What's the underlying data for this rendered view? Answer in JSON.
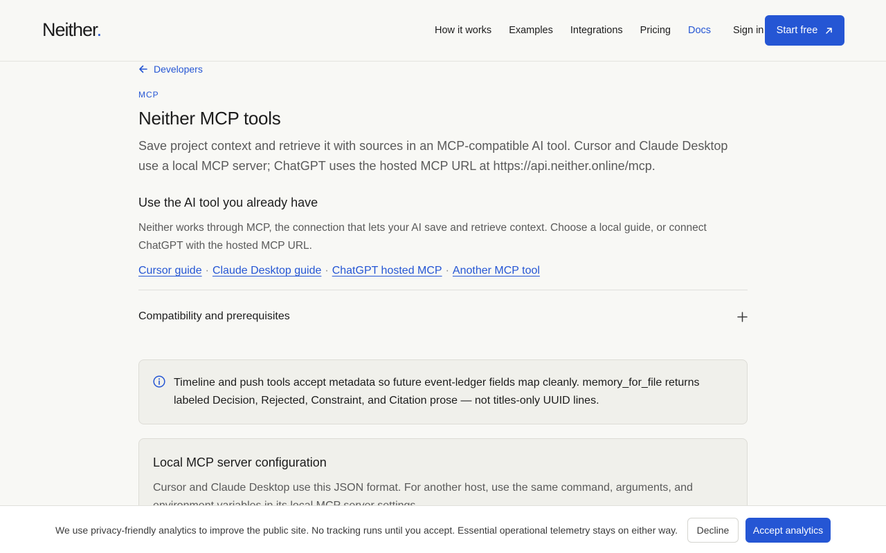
{
  "header": {
    "logo_text": "Neither",
    "logo_dot": ".",
    "nav": [
      {
        "label": "How it works"
      },
      {
        "label": "Examples"
      },
      {
        "label": "Integrations"
      },
      {
        "label": "Pricing"
      },
      {
        "label": "Docs",
        "active": true
      }
    ],
    "sign_in": "Sign in",
    "start_free": "Start free"
  },
  "main": {
    "back_link": "Developers",
    "eyebrow": "MCP",
    "title": "Neither MCP tools",
    "lead": "Save project context and retrieve it with sources in an MCP-compatible AI tool. Cursor and Claude Desktop use a local MCP server; ChatGPT uses the hosted MCP URL at https://api.neither.online/mcp.",
    "section_heading": "Use the AI tool you already have",
    "section_text": "Neither works through MCP, the connection that lets your AI save and retrieve context. Choose a local guide, or connect ChatGPT with the hosted MCP URL.",
    "links": [
      "Cursor guide",
      "Claude Desktop guide",
      "ChatGPT hosted MCP",
      "Another MCP tool"
    ],
    "link_separator": "·",
    "accordion_label": "Compatibility and prerequisites",
    "note": "Timeline and push tools accept metadata so future event-ledger fields map cleanly. memory_for_file returns labeled Decision, Rejected, Constraint, and Citation prose — not titles-only UUID lines.",
    "config_title": "Local MCP server configuration",
    "config_text": "Cursor and Claude Desktop use this JSON format. For another host, use the same command, arguments, and environment variables in its local MCP server settings."
  },
  "cookie": {
    "message": "We use privacy-friendly analytics to improve the public site. No tracking runs until you accept. Essential operational telemetry stays on either way.",
    "decline": "Decline",
    "accept": "Accept analytics"
  },
  "colors": {
    "accent": "#2556d4",
    "background": "#f8f8f5"
  },
  "icons": {
    "back": "arrow-left-icon",
    "start": "arrow-up-right-icon",
    "accordion": "plus-icon",
    "note": "info-icon"
  }
}
